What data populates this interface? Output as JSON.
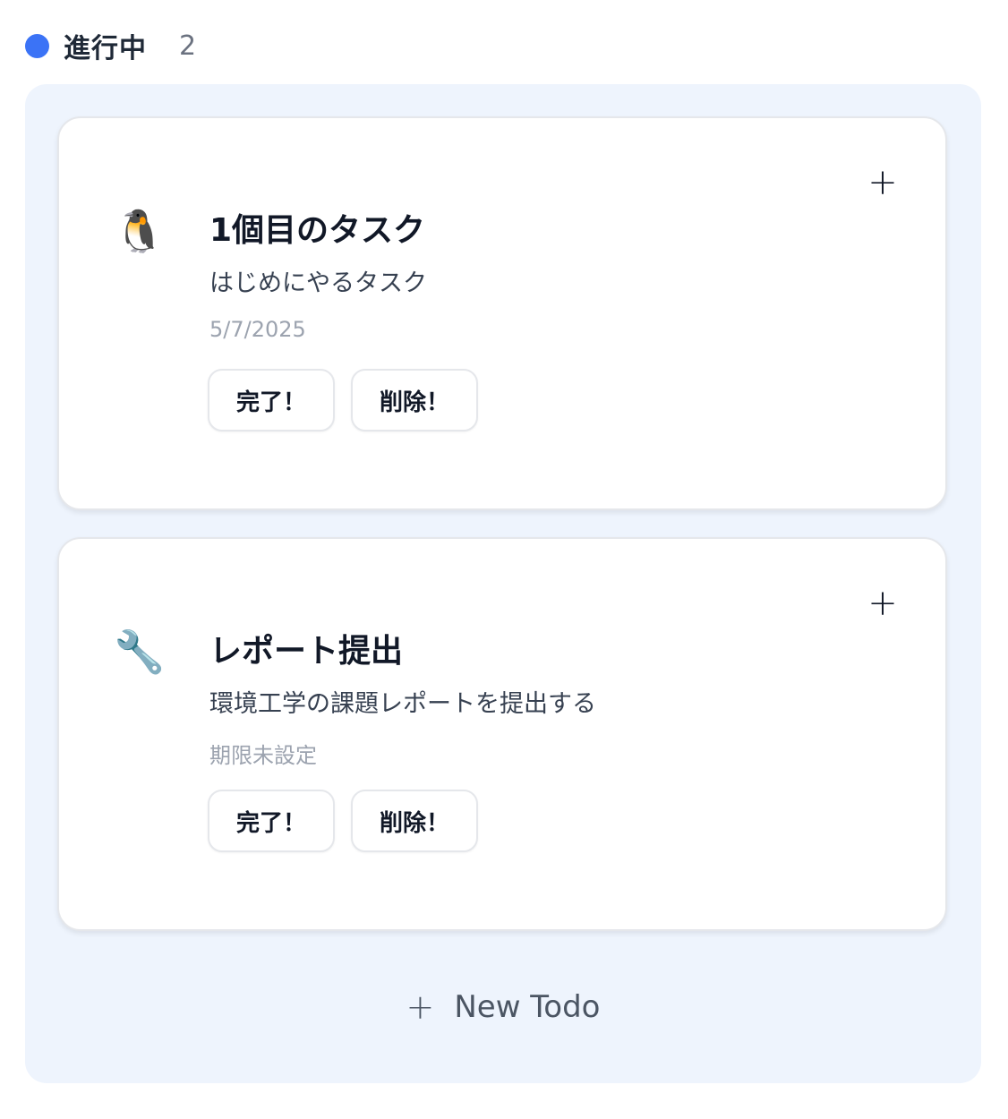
{
  "column": {
    "title": "進行中",
    "count": "2",
    "dot_color": "#3b73f6",
    "background": "#eef4fd"
  },
  "cards": [
    {
      "emoji": "🐧",
      "icon_name": "penguin-icon",
      "title": "1個目のタスク",
      "description": "はじめにやるタスク",
      "due": "5/7/2025",
      "add_symbol": "+",
      "complete_label": "完了！",
      "delete_label": "削除！"
    },
    {
      "emoji": "🔧",
      "icon_name": "wrench-icon",
      "title": "レポート提出",
      "description": "環境工学の課題レポートを提出する",
      "due": "期限未設定",
      "add_symbol": "+",
      "complete_label": "完了！",
      "delete_label": "削除！"
    }
  ],
  "new_todo": {
    "icon": "+",
    "label": "New Todo"
  }
}
